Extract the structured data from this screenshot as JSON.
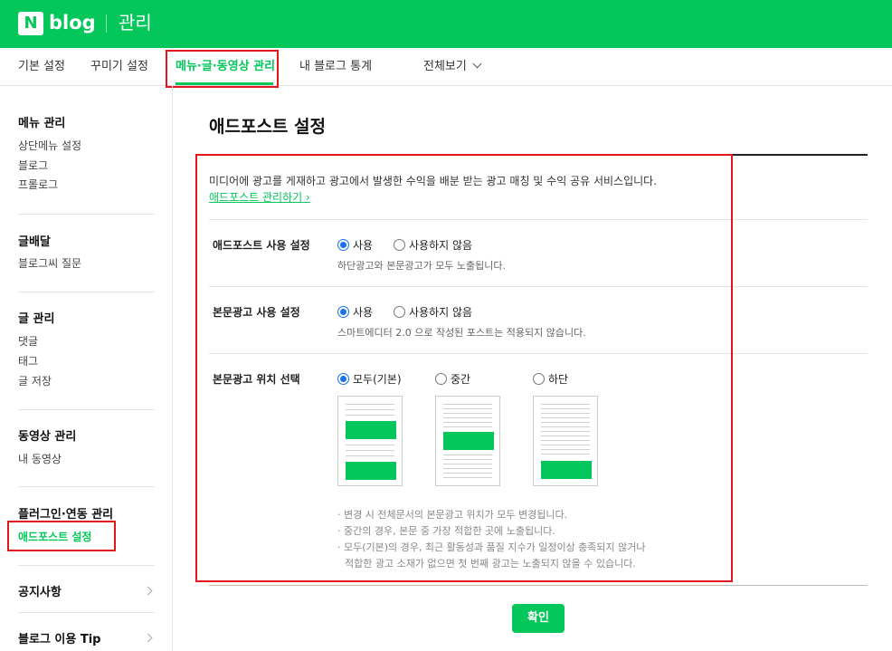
{
  "header": {
    "logo_mark": "N",
    "logo_text": "blog",
    "title": "관리"
  },
  "tabs": [
    {
      "label": "기본 설정"
    },
    {
      "label": "꾸미기 설정"
    },
    {
      "label": "메뉴·글·동영상 관리",
      "active": true
    },
    {
      "label": "내 블로그 통계"
    },
    {
      "label": "전체보기"
    }
  ],
  "sidebar": {
    "sections": [
      {
        "title": "메뉴 관리",
        "items": [
          "상단메뉴 설정",
          "블로그",
          "프롤로그"
        ]
      },
      {
        "title": "글배달",
        "items": [
          "블로그씨 질문"
        ]
      },
      {
        "title": "글 관리",
        "items": [
          "댓글",
          "태그",
          "글 저장"
        ]
      },
      {
        "title": "동영상 관리",
        "items": [
          "내 동영상"
        ]
      },
      {
        "title": "플러그인·연동 관리",
        "items": [
          "애드포스트 설정"
        ]
      },
      {
        "title": "공지사항"
      },
      {
        "title": "블로그 이용 Tip"
      }
    ]
  },
  "main": {
    "title": "애드포스트 설정",
    "description": "미디어에 광고를 게재하고 광고에서 발생한 수익을 배분 받는 광고 매칭 및 수익 공유 서비스입니다.",
    "manage_link": "애드포스트 관리하기",
    "settings": [
      {
        "label": "애드포스트 사용 설정",
        "options": [
          "사용",
          "사용하지 않음"
        ],
        "selected": "사용",
        "help": "하단광고와 본문광고가 모두 노출됩니다."
      },
      {
        "label": "본문광고 사용 설정",
        "options": [
          "사용",
          "사용하지 않음"
        ],
        "selected": "사용",
        "help": "스마트에디터 2.0 으로 작성된 포스트는 적용되지 않습니다."
      },
      {
        "label": "본문광고 위치 선택",
        "options": [
          "모두(기본)",
          "중간",
          "하단"
        ],
        "selected": "모두(기본)"
      }
    ],
    "notes": [
      "· 변경 시 전체문서의 본문광고 위치가 모두 변경됩니다.",
      "· 중간의 경우, 본문 중 가장 적합한 곳에 노출됩니다.",
      "· 모두(기본)의 경우, 최근 활동성과 품질 지수가 일정이상 충족되지 않거나",
      "적합한 광고 소재가 없으면 첫 번째 광고는 노출되지 않을 수 있습니다."
    ],
    "confirm_label": "확인"
  },
  "colors": {
    "brand": "#03c75a",
    "highlight_box": "#e3161c",
    "radio_selected": "#1a73e8"
  }
}
